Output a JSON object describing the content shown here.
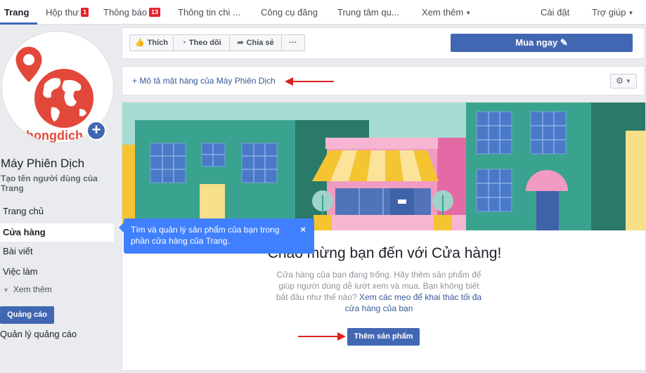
{
  "nav": {
    "items": [
      {
        "label": "Trang"
      },
      {
        "label": "Hộp thư",
        "badge": "1"
      },
      {
        "label": "Thông báo",
        "badge": "13"
      },
      {
        "label": "Thông tin chi ..."
      },
      {
        "label": "Công cụ đăng"
      },
      {
        "label": "Trung tâm qu..."
      },
      {
        "label": "Xem thêm"
      },
      {
        "label": "Cài đặt"
      },
      {
        "label": "Trợ giúp"
      }
    ]
  },
  "sidebar": {
    "page_name": "Máy Phiên Dịch",
    "username_prompt": "Tạo tên người dùng của Trang",
    "avatar_logo_text": "thongdich",
    "links": [
      {
        "label": "Trang chủ"
      },
      {
        "label": "Cửa hàng"
      },
      {
        "label": "Bài viết"
      },
      {
        "label": "Việc làm"
      }
    ],
    "see_more": "Xem thêm",
    "ads_button": "Quảng cáo",
    "ads_manager": "Quản lý quảng cáo"
  },
  "actions": {
    "like": "Thích",
    "follow": "Theo dõi",
    "share": "Chia sẻ",
    "more": "···",
    "buy_now": "Mua ngay"
  },
  "describe": {
    "link": "+ Mô tả mặt hàng của Máy Phiên Dịch"
  },
  "shop": {
    "welcome_title": "Chào mừng bạn đến với Cửa hàng!",
    "description": "Cửa hàng của bạn đang trống. Hãy thêm sản phẩm để giúp người dùng dễ lướt xem và mua. Bạn không biết bắt đầu như thế nào?",
    "tips_link": "Xem các mẹo để khai thác tối đa cửa hàng của bạn",
    "add_product": "Thêm sản phẩm"
  },
  "tooltip": {
    "text": "Tìm và quản lý sản phẩm của bạn trong phần cửa hàng của Trang.",
    "close": "×"
  },
  "colors": {
    "brand_blue": "#4267b2",
    "tooltip_blue": "#4080ff",
    "badge_red": "#e4222e",
    "annotation_red": "#e02020"
  }
}
